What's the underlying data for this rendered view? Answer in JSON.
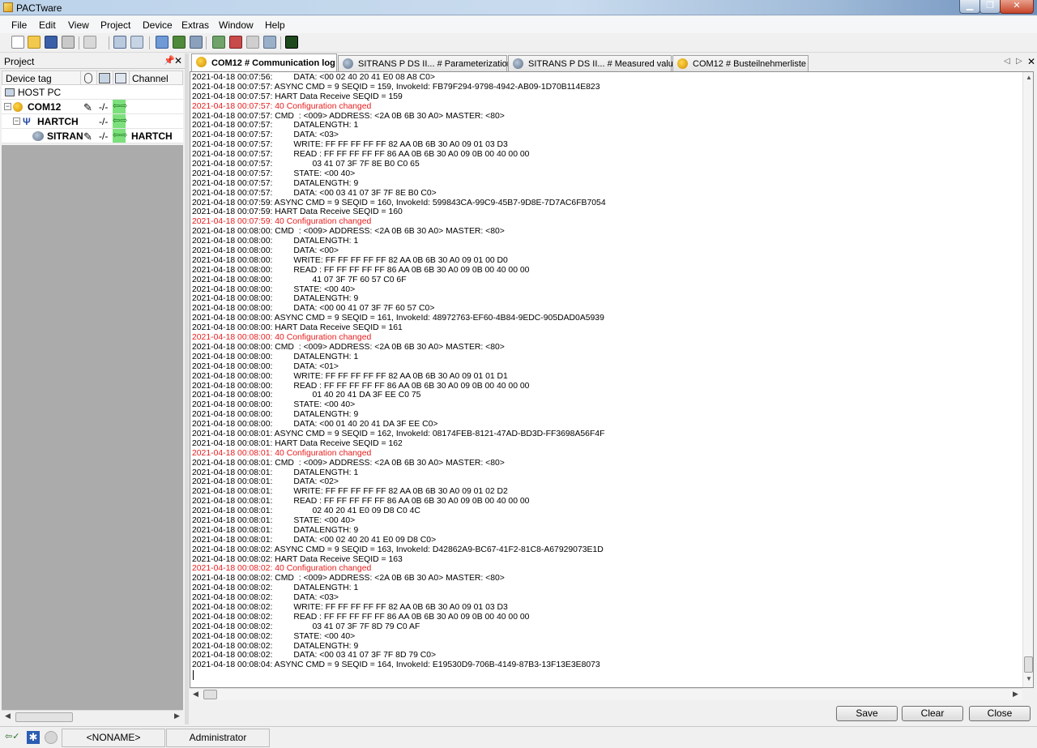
{
  "window": {
    "title": "PACTware"
  },
  "menu": [
    "File",
    "Edit",
    "View",
    "Project",
    "Device",
    "Extras",
    "Window",
    "Help"
  ],
  "project_panel": {
    "title": "Project",
    "columns": {
      "device_tag": "Device tag",
      "channel": "Channel"
    },
    "rows": [
      {
        "tag": "HOST PC",
        "channel": ""
      },
      {
        "tag": "COM12",
        "channel": ""
      },
      {
        "tag": "HARTCH",
        "channel": ""
      },
      {
        "tag": "SITRAN",
        "channel": "HARTCH"
      }
    ]
  },
  "tabs": [
    {
      "label": "COM12 # Communication log",
      "active": true
    },
    {
      "label": "SITRANS P DS II... # Parameterization",
      "active": false
    },
    {
      "label": "SITRANS P DS II... # Measured value",
      "active": false
    },
    {
      "label": "COM12 # Busteilnehmerliste",
      "active": false
    }
  ],
  "log_lines": [
    {
      "t": "2021-04-18 00:07:56:         DATA: <00 02 40 20 41 E0 08 A8 C0>",
      "red": false
    },
    {
      "t": "2021-04-18 00:07:57: ASYNC CMD = 9 SEQID = 159, InvokeId: FB79F294-9798-4942-AB09-1D70B114E823",
      "red": false
    },
    {
      "t": "2021-04-18 00:07:57: HART Data Receive SEQID = 159",
      "red": false
    },
    {
      "t": "2021-04-18 00:07:57: 40 Configuration changed",
      "red": true
    },
    {
      "t": "2021-04-18 00:07:57: CMD  : <009> ADDRESS: <2A 0B 6B 30 A0> MASTER: <80>",
      "red": false
    },
    {
      "t": "2021-04-18 00:07:57:         DATALENGTH: 1",
      "red": false
    },
    {
      "t": "2021-04-18 00:07:57:         DATA: <03>",
      "red": false
    },
    {
      "t": "2021-04-18 00:07:57:         WRITE: FF FF FF FF FF 82 AA 0B 6B 30 A0 09 01 03 D3",
      "red": false
    },
    {
      "t": "2021-04-18 00:07:57:         READ : FF FF FF FF FF 86 AA 0B 6B 30 A0 09 0B 00 40 00 00",
      "red": false
    },
    {
      "t": "2021-04-18 00:07:57:                 03 41 07 3F 7F 8E B0 C0 65",
      "red": false
    },
    {
      "t": "2021-04-18 00:07:57:         STATE: <00 40>",
      "red": false
    },
    {
      "t": "2021-04-18 00:07:57:         DATALENGTH: 9",
      "red": false
    },
    {
      "t": "2021-04-18 00:07:57:         DATA: <00 03 41 07 3F 7F 8E B0 C0>",
      "red": false
    },
    {
      "t": "2021-04-18 00:07:59: ASYNC CMD = 9 SEQID = 160, InvokeId: 599843CA-99C9-45B7-9D8E-7D7AC6FB7054",
      "red": false
    },
    {
      "t": "2021-04-18 00:07:59: HART Data Receive SEQID = 160",
      "red": false
    },
    {
      "t": "2021-04-18 00:07:59: 40 Configuration changed",
      "red": true
    },
    {
      "t": "2021-04-18 00:08:00: CMD  : <009> ADDRESS: <2A 0B 6B 30 A0> MASTER: <80>",
      "red": false
    },
    {
      "t": "2021-04-18 00:08:00:         DATALENGTH: 1",
      "red": false
    },
    {
      "t": "2021-04-18 00:08:00:         DATA: <00>",
      "red": false
    },
    {
      "t": "2021-04-18 00:08:00:         WRITE: FF FF FF FF FF 82 AA 0B 6B 30 A0 09 01 00 D0",
      "red": false
    },
    {
      "t": "2021-04-18 00:08:00:         READ : FF FF FF FF FF 86 AA 0B 6B 30 A0 09 0B 00 40 00 00",
      "red": false
    },
    {
      "t": "2021-04-18 00:08:00:                 41 07 3F 7F 60 57 C0 6F",
      "red": false
    },
    {
      "t": "2021-04-18 00:08:00:         STATE: <00 40>",
      "red": false
    },
    {
      "t": "2021-04-18 00:08:00:         DATALENGTH: 9",
      "red": false
    },
    {
      "t": "2021-04-18 00:08:00:         DATA: <00 00 41 07 3F 7F 60 57 C0>",
      "red": false
    },
    {
      "t": "2021-04-18 00:08:00: ASYNC CMD = 9 SEQID = 161, InvokeId: 48972763-EF60-4B84-9EDC-905DAD0A5939",
      "red": false
    },
    {
      "t": "2021-04-18 00:08:00: HART Data Receive SEQID = 161",
      "red": false
    },
    {
      "t": "2021-04-18 00:08:00: 40 Configuration changed",
      "red": true
    },
    {
      "t": "2021-04-18 00:08:00: CMD  : <009> ADDRESS: <2A 0B 6B 30 A0> MASTER: <80>",
      "red": false
    },
    {
      "t": "2021-04-18 00:08:00:         DATALENGTH: 1",
      "red": false
    },
    {
      "t": "2021-04-18 00:08:00:         DATA: <01>",
      "red": false
    },
    {
      "t": "2021-04-18 00:08:00:         WRITE: FF FF FF FF FF 82 AA 0B 6B 30 A0 09 01 01 D1",
      "red": false
    },
    {
      "t": "2021-04-18 00:08:00:         READ : FF FF FF FF FF 86 AA 0B 6B 30 A0 09 0B 00 40 00 00",
      "red": false
    },
    {
      "t": "2021-04-18 00:08:00:                 01 40 20 41 DA 3F EE C0 75",
      "red": false
    },
    {
      "t": "2021-04-18 00:08:00:         STATE: <00 40>",
      "red": false
    },
    {
      "t": "2021-04-18 00:08:00:         DATALENGTH: 9",
      "red": false
    },
    {
      "t": "2021-04-18 00:08:00:         DATA: <00 01 40 20 41 DA 3F EE C0>",
      "red": false
    },
    {
      "t": "2021-04-18 00:08:01: ASYNC CMD = 9 SEQID = 162, InvokeId: 08174FEB-8121-47AD-BD3D-FF3698A56F4F",
      "red": false
    },
    {
      "t": "2021-04-18 00:08:01: HART Data Receive SEQID = 162",
      "red": false
    },
    {
      "t": "2021-04-18 00:08:01: 40 Configuration changed",
      "red": true
    },
    {
      "t": "2021-04-18 00:08:01: CMD  : <009> ADDRESS: <2A 0B 6B 30 A0> MASTER: <80>",
      "red": false
    },
    {
      "t": "2021-04-18 00:08:01:         DATALENGTH: 1",
      "red": false
    },
    {
      "t": "2021-04-18 00:08:01:         DATA: <02>",
      "red": false
    },
    {
      "t": "2021-04-18 00:08:01:         WRITE: FF FF FF FF FF 82 AA 0B 6B 30 A0 09 01 02 D2",
      "red": false
    },
    {
      "t": "2021-04-18 00:08:01:         READ : FF FF FF FF FF 86 AA 0B 6B 30 A0 09 0B 00 40 00 00",
      "red": false
    },
    {
      "t": "2021-04-18 00:08:01:                 02 40 20 41 E0 09 D8 C0 4C",
      "red": false
    },
    {
      "t": "2021-04-18 00:08:01:         STATE: <00 40>",
      "red": false
    },
    {
      "t": "2021-04-18 00:08:01:         DATALENGTH: 9",
      "red": false
    },
    {
      "t": "2021-04-18 00:08:01:         DATA: <00 02 40 20 41 E0 09 D8 C0>",
      "red": false
    },
    {
      "t": "2021-04-18 00:08:02: ASYNC CMD = 9 SEQID = 163, InvokeId: D42862A9-BC67-41F2-81C8-A67929073E1D",
      "red": false
    },
    {
      "t": "2021-04-18 00:08:02: HART Data Receive SEQID = 163",
      "red": false
    },
    {
      "t": "2021-04-18 00:08:02: 40 Configuration changed",
      "red": true
    },
    {
      "t": "2021-04-18 00:08:02: CMD  : <009> ADDRESS: <2A 0B 6B 30 A0> MASTER: <80>",
      "red": false
    },
    {
      "t": "2021-04-18 00:08:02:         DATALENGTH: 1",
      "red": false
    },
    {
      "t": "2021-04-18 00:08:02:         DATA: <03>",
      "red": false
    },
    {
      "t": "2021-04-18 00:08:02:         WRITE: FF FF FF FF FF 82 AA 0B 6B 30 A0 09 01 03 D3",
      "red": false
    },
    {
      "t": "2021-04-18 00:08:02:         READ : FF FF FF FF FF 86 AA 0B 6B 30 A0 09 0B 00 40 00 00",
      "red": false
    },
    {
      "t": "2021-04-18 00:08:02:                 03 41 07 3F 7F 8D 79 C0 AF",
      "red": false
    },
    {
      "t": "2021-04-18 00:08:02:         STATE: <00 40>",
      "red": false
    },
    {
      "t": "2021-04-18 00:08:02:         DATALENGTH: 9",
      "red": false
    },
    {
      "t": "2021-04-18 00:08:02:         DATA: <00 03 41 07 3F 7F 8D 79 C0>",
      "red": false
    },
    {
      "t": "2021-04-18 00:08:04: ASYNC CMD = 9 SEQID = 164, InvokeId: E19530D9-706B-4149-87B3-13F13E3E8073",
      "red": false
    }
  ],
  "buttons": {
    "save": "Save",
    "clear": "Clear",
    "close": "Close"
  },
  "status": {
    "project": "<NONAME>",
    "user": "Administrator"
  },
  "colors": {
    "error_text": "#e81c1c",
    "channel_green": "#7be07b"
  }
}
